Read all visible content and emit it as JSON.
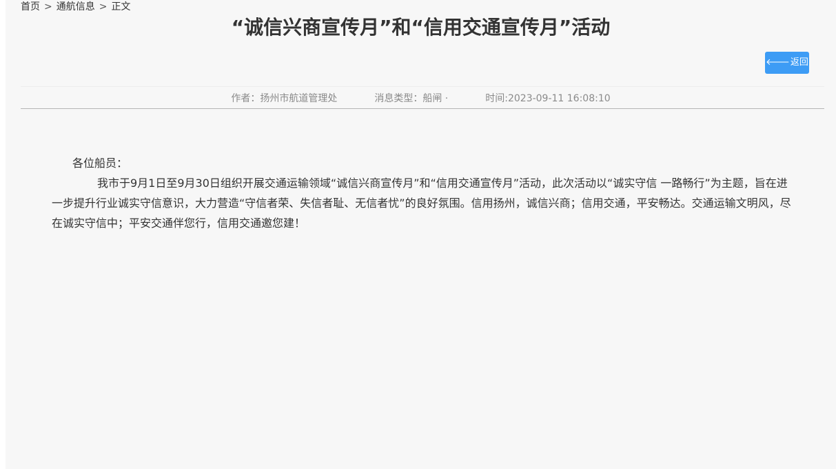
{
  "breadcrumb": {
    "home": "首页",
    "section": "通航信息",
    "current": "正文",
    "separator": ">"
  },
  "article": {
    "title": "“诚信兴商宣传月”和“信用交通宣传月”活动",
    "author": "作者：扬州市航道管理处",
    "message_type": "消息类型：船闸 ·",
    "time": "时间:2023-09-11 16:08:10",
    "greeting": "各位船员：",
    "body": "我市于9月1日至9月30日组织开展交通运输领域“诚信兴商宣传月”和“信用交通宣传月”活动，此次活动以“诚实守信 一路畅行”为主题，旨在进一步提升行业诚实守信意识，大力营造“守信者荣、失信者耻、无信者忧”的良好氛围。信用扬州，诚信兴商；信用交通，平安畅达。交通运输文明风，尽在诚实守信中；平安交通伴您行，信用交通邀您建！"
  },
  "toolbar": {
    "back_label": "返回",
    "back_icon": "arrow-left-icon"
  },
  "colors": {
    "button": "#3d9cf5",
    "background": "#f7f7f7",
    "meta_text": "#8a8a8a"
  }
}
